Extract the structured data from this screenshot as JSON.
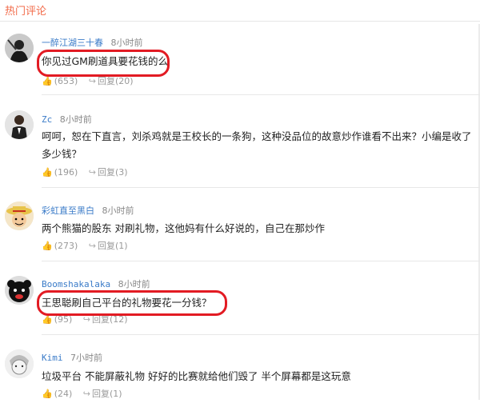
{
  "section": {
    "title": "热门评论"
  },
  "comments": [
    {
      "username": "一醉江湖三十春",
      "time": "8小时前",
      "text": "你见过GM刷道具要花钱的么",
      "likes": "(653)",
      "reply": "回复(20)",
      "avatar": "avatar-dark-figure"
    },
    {
      "username": "Zc",
      "time": "8小时前",
      "text": "呵呵，恕在下直言，刘杀鸡就是王校长的一条狗，这种没品位的故意炒作谁看不出来？小编是收了多少钱？",
      "likes": "(196)",
      "reply": "回复(3)",
      "avatar": "avatar-suited-man"
    },
    {
      "username": "彩虹直至黑白",
      "time": "8小时前",
      "text": "两个熊猫的股东 对刷礼物，这他妈有什么好说的，自己在那炒作",
      "likes": "(273)",
      "reply": "回复(1)",
      "avatar": "avatar-straw-hat"
    },
    {
      "username": "Boomshakalaka",
      "time": "8小时前",
      "text": "王思聪刷自己平台的礼物要花一分钱？",
      "likes": "(95)",
      "reply": "回复(12)",
      "avatar": "avatar-black-bear"
    },
    {
      "username": "Kimi",
      "time": "7小时前",
      "text": "垃圾平台 不能屏蔽礼物 好好的比赛就给他们毁了 半个屏幕都是这玩意",
      "likes": "(24)",
      "reply": "回复(1)",
      "avatar": "avatar-sketch-character"
    }
  ],
  "colors": {
    "accent": "#f26b4a",
    "username": "#3a7bc8",
    "highlight": "#e21b23"
  }
}
